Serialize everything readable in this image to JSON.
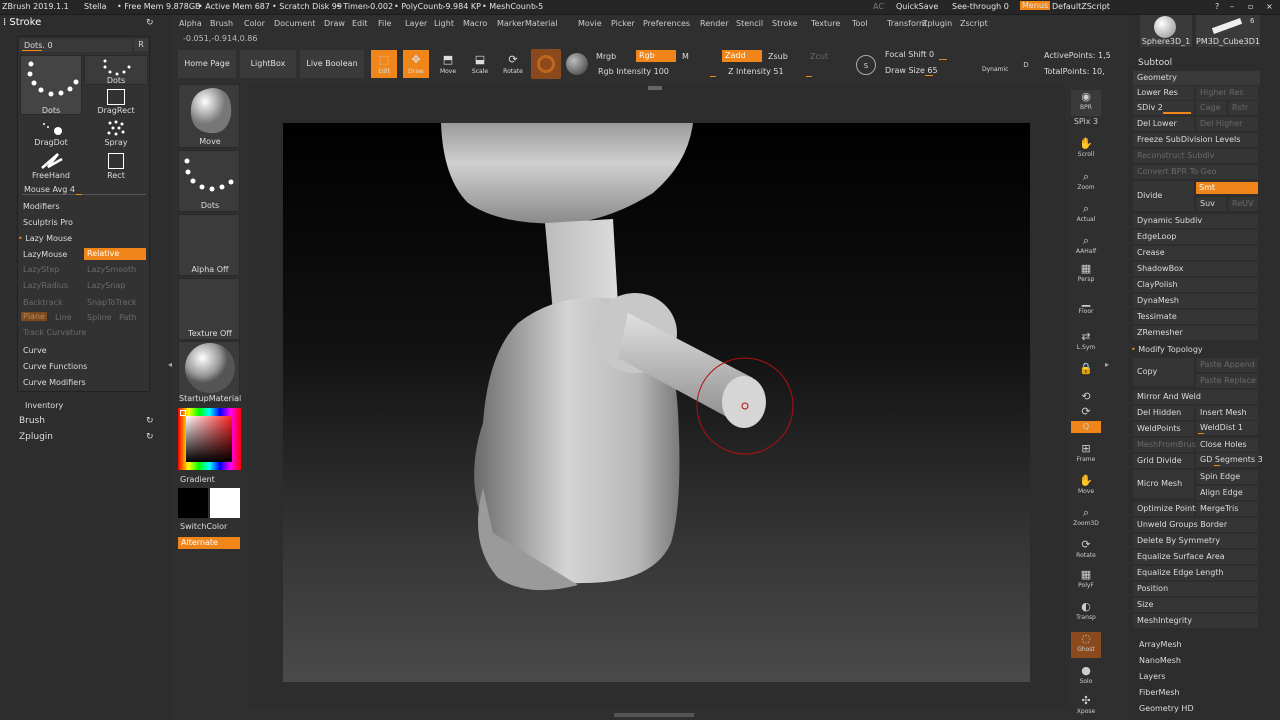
{
  "titlebar": {
    "app": "ZBrush 2019.1.1",
    "project": "Stella",
    "free_mem": "• Free Mem 9.878GB",
    "active_mem": "• Active Mem 687",
    "scratch": "• Scratch Disk 99",
    "timer": "• Timer▹0.002",
    "polycount": "• PolyCount▹9.984 KP",
    "meshcount": "• MeshCount▹5",
    "ac": "AC",
    "quicksave": "QuickSave",
    "seethrough": "See-through  0",
    "menus": "Menus",
    "script": "DefaultZScript"
  },
  "menubar": [
    "Alpha",
    "Brush",
    "Color",
    "Document",
    "Draw",
    "Edit",
    "File",
    "Layer",
    "Light",
    "Macro",
    "Marker",
    "Material",
    "Movie",
    "Picker",
    "Preferences",
    "Render",
    "Stencil",
    "Stroke",
    "Texture",
    "Tool",
    "Transform",
    "Zplugin",
    "Zscript"
  ],
  "coords": "-0.051,-0.914,0.86",
  "stroke": {
    "title": "Stroke",
    "dots_slider": "Dots. 0",
    "r_btn": "R",
    "brushes": [
      {
        "label": "Dots"
      },
      {
        "label": "Dots"
      },
      {
        "label": "DragRect"
      },
      {
        "label": "DragDot"
      },
      {
        "label": "Spray"
      },
      {
        "label": "FreeHand"
      },
      {
        "label": "Rect"
      }
    ],
    "mouse_avg": "Mouse Avg 4",
    "modifiers": "Modifiers",
    "sculptris": "Sculptris Pro",
    "lazymouse": "Lazy Mouse",
    "lazymouse_btn": "LazyMouse",
    "relative": "Relative",
    "lazystep": "LazyStep",
    "lazysmooth": "LazySmooth",
    "lazyradius": "LazyRadius",
    "lazysnap": "LazySnap",
    "backtrack": "Backtrack",
    "snaptotrack": "SnapToTrack",
    "plane": "Plane",
    "line": "Line",
    "spline": "Spline",
    "path": "Path",
    "track_curvature": "Track Curvature",
    "curve": "Curve",
    "curve_functions": "Curve Functions",
    "curve_modifiers": "Curve Modifiers"
  },
  "lowerleft": {
    "inventory": "Inventory",
    "brush": "Brush",
    "zplugin": "Zplugin"
  },
  "col2": {
    "move": "Move",
    "dots": "Dots",
    "alpha": "Alpha Off",
    "texture": "Texture Off",
    "material": "StartupMaterial",
    "gradient": "Gradient",
    "switchcolor": "SwitchColor",
    "alternate": "Alternate"
  },
  "shelf": {
    "homepage": "Home Page",
    "lightbox": "LightBox",
    "liveboolean": "Live Boolean",
    "edit": "Edit",
    "draw": "Draw",
    "move": "Move",
    "scale": "Scale",
    "rotate": "Rotate",
    "mrgb": "Mrgb",
    "rgb": "Rgb",
    "m": "M",
    "rgb_intensity": "Rgb Intensity 100",
    "zadd": "Zadd",
    "zsub": "Zsub",
    "zcut": "Zcut",
    "z_intensity": "Z Intensity 51",
    "focal_shift": "Focal Shift 0",
    "draw_size": "Draw Size 65",
    "dynamic": "Dynamic",
    "active_points": "ActivePoints: 1,5",
    "total_points": "TotalPoints: 10,"
  },
  "ricons": [
    "BPR",
    "SPix 3",
    "Scroll",
    "Zoom",
    "Actual",
    "AAHalf",
    "Persp",
    "Floor",
    "L.Sym",
    "",
    "Xyz",
    "",
    "Frame",
    "Move",
    "Zoom3D",
    "Rotate",
    "PolyF",
    "Transp",
    "Ghost",
    "Solo",
    "Xpose"
  ],
  "righttray": {
    "tool_thumb1": "Sphere3D_1",
    "tool_thumb2": "PM3D_Cube3D1",
    "tool_count": "6",
    "subtool": "Subtool",
    "geometry": "Geometry",
    "lower_res": "Lower Res",
    "higher_res": "Higher Res",
    "sdiv": "SDiv 2",
    "cage": "Cage",
    "rstr": "Rstr",
    "del_lower": "Del Lower",
    "del_higher": "Del Higher",
    "freeze": "Freeze SubDivision Levels",
    "reconstruct": "Reconstruct Subdiv",
    "convert_bpr": "Convert BPR To Geo",
    "divide": "Divide",
    "smt": "Smt",
    "suv": "Suv",
    "reuv": "ReUV",
    "dynamic_subdiv": "Dynamic Subdiv",
    "edgeloop": "EdgeLoop",
    "crease": "Crease",
    "shadowbox": "ShadowBox",
    "claypolish": "ClayPolish",
    "dynamesh": "DynaMesh",
    "tessimate": "Tessimate",
    "zremesher": "ZRemesher",
    "modify_topology": "Modify Topology",
    "copy": "Copy",
    "paste_append": "Paste Append",
    "paste_replace": "Paste Replace",
    "mirror_weld": "Mirror And Weld",
    "del_hidden": "Del Hidden",
    "insert_mesh": "Insert Mesh",
    "weldpoints": "WeldPoints",
    "welddist": "WeldDist 1",
    "meshfrombrush": "MeshFromBrush",
    "close_holes": "Close Holes",
    "grid_divide": "Grid Divide",
    "gd_segments": "GD Segments 3",
    "micro_mesh": "Micro Mesh",
    "spin_edge": "Spin Edge",
    "align_edge": "Align Edge",
    "optimize_points": "Optimize Points",
    "mergetris": "MergeTris",
    "unweld": "Unweld Groups Border",
    "delete_symmetry": "Delete By Symmetry",
    "equalize_area": "Equalize Surface Area",
    "equalize_edge": "Equalize Edge Length",
    "position": "Position",
    "size": "Size",
    "meshintegrity": "MeshIntegrity",
    "arraymesh": "ArrayMesh",
    "nanomesh": "NanoMesh",
    "layers": "Layers",
    "fibermesh": "FiberMesh",
    "geometry_hd": "Geometry HD"
  },
  "colors": {
    "accent": "#f0851a",
    "bg": "#2f2f2f",
    "panel": "#353535"
  }
}
